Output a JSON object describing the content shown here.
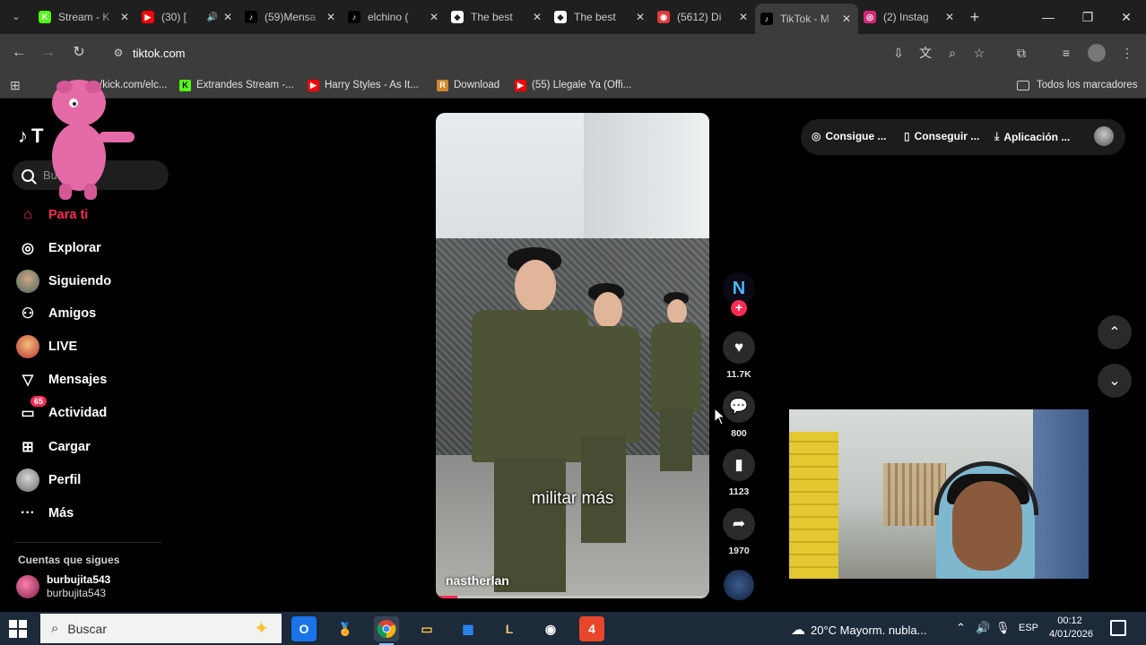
{
  "browser": {
    "tabs": [
      {
        "title": "Stream - K",
        "favicon": "kick-icon",
        "color": "#53fc18",
        "glyph": "K"
      },
      {
        "title": "(30) [",
        "favicon": "youtube-icon",
        "color": "#ff0000",
        "glyph": "▶",
        "audio": true
      },
      {
        "title": "(59)Mensa",
        "favicon": "tiktok-icon",
        "color": "#000000",
        "glyph": "♪"
      },
      {
        "title": "elchino (",
        "favicon": "tiktok-icon",
        "color": "#000000",
        "glyph": "♪"
      },
      {
        "title": "The best",
        "favicon": "diamond-icon",
        "color": "#ffffff",
        "glyph": "◆"
      },
      {
        "title": "The best",
        "favicon": "diamond-icon",
        "color": "#ffffff",
        "glyph": "◆"
      },
      {
        "title": "(5612) Di",
        "favicon": "discord-icon",
        "color": "#e03a3a",
        "glyph": "◉"
      },
      {
        "title": "TikTok - M",
        "favicon": "tiktok-icon",
        "color": "#000000",
        "glyph": "♪",
        "active": true
      },
      {
        "title": "(2) Instag",
        "favicon": "instagram-icon",
        "color": "#d62976",
        "glyph": "◎"
      }
    ],
    "url": "tiktok.com",
    "bookmarks": [
      {
        "label": "/kick.com/elc...",
        "favicon": "kick-icon"
      },
      {
        "label": "Extrandes Stream -...",
        "favicon": "kick-icon"
      },
      {
        "label": "Harry Styles - As It...",
        "favicon": "youtube-icon"
      },
      {
        "label": "Download",
        "favicon": "download-icon"
      },
      {
        "label": "(55) Llegale Ya (Offi...",
        "favicon": "youtube-icon"
      }
    ],
    "all_bookmarks": "Todos los marcadores"
  },
  "tiktok": {
    "logo_text": "T",
    "search_placeholder": "Bus",
    "nav": [
      {
        "label": "Para ti",
        "icon": "home-icon",
        "active": true
      },
      {
        "label": "Explorar",
        "icon": "compass-icon"
      },
      {
        "label": "Siguiendo",
        "icon": "following-avatar-icon"
      },
      {
        "label": "Amigos",
        "icon": "friends-icon"
      },
      {
        "label": "LIVE",
        "icon": "live-icon"
      },
      {
        "label": "Mensajes",
        "icon": "messages-icon"
      },
      {
        "label": "Actividad",
        "icon": "activity-icon",
        "badge": "65"
      },
      {
        "label": "Cargar",
        "icon": "upload-icon"
      },
      {
        "label": "Perfil",
        "icon": "profile-icon"
      },
      {
        "label": "Más",
        "icon": "more-icon"
      }
    ],
    "following_title": "Cuentas que sigues",
    "following": [
      {
        "name": "burbujita543",
        "handle": "burbujita543"
      }
    ],
    "top_actions": [
      {
        "label": "Consigue ...",
        "icon": "coin-icon"
      },
      {
        "label": "Conseguir ...",
        "icon": "phone-icon"
      },
      {
        "label": "Aplicación ...",
        "icon": "download-icon"
      }
    ],
    "video": {
      "caption": "militar más",
      "author": "nastherlan",
      "progress": 0.08
    },
    "actions": {
      "likes": "11.7K",
      "comments": "800",
      "saves": "1123",
      "shares": "1970"
    }
  },
  "taskbar": {
    "search": "Buscar",
    "weather": "20°C  Mayorm. nubla...",
    "lang": "ESP",
    "time": "00:12",
    "date": "4/01/2026"
  }
}
